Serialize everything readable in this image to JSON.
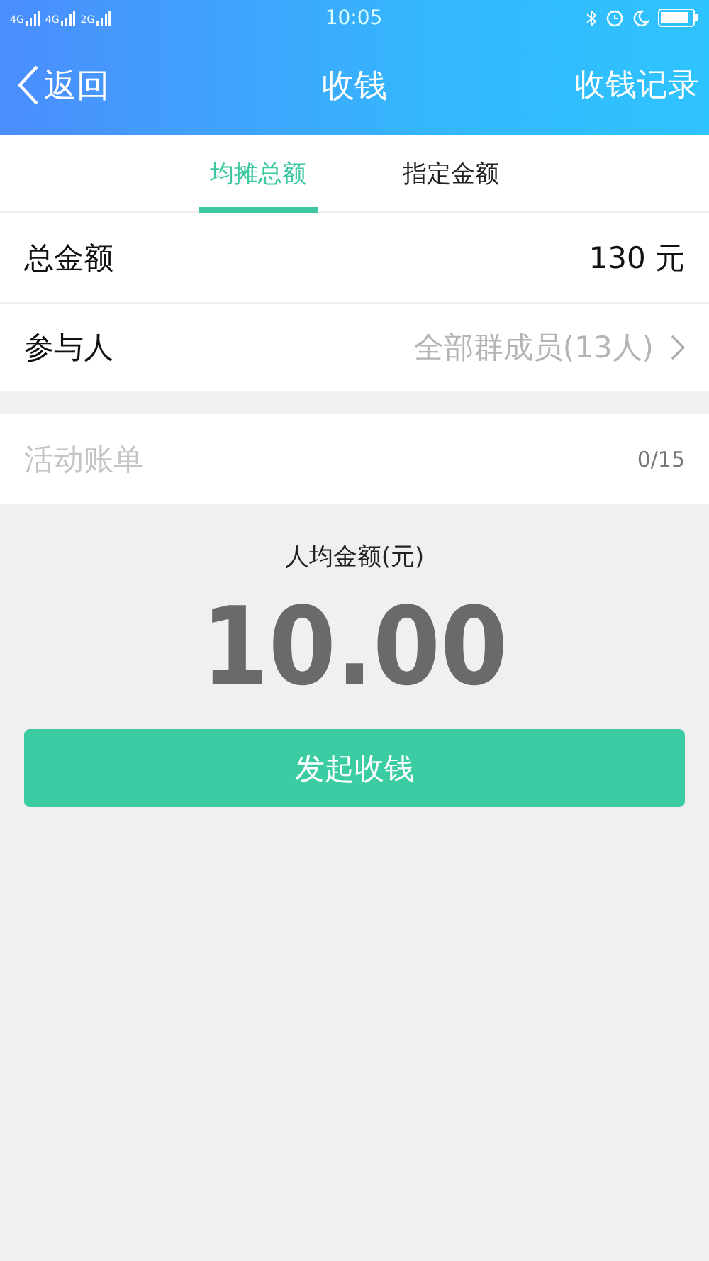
{
  "status_bar": {
    "networks": [
      "4G",
      "4G",
      "2G"
    ],
    "time": "10:05"
  },
  "nav": {
    "back": "返回",
    "title": "收钱",
    "action": "收钱记录"
  },
  "tabs": [
    {
      "label": "均摊总额",
      "selected": true
    },
    {
      "label": "指定金额",
      "selected": false
    }
  ],
  "rows": [
    {
      "label": "总金额",
      "value": "130 元",
      "kind": "value"
    },
    {
      "label": "参与人",
      "value": "全部群成员(13人)",
      "kind": "link"
    }
  ],
  "memo": {
    "placeholder": "活动账单",
    "counter": "0/15"
  },
  "per_person": {
    "label": "人均金额(元)",
    "amount": "10.00"
  },
  "submit": "发起收钱"
}
